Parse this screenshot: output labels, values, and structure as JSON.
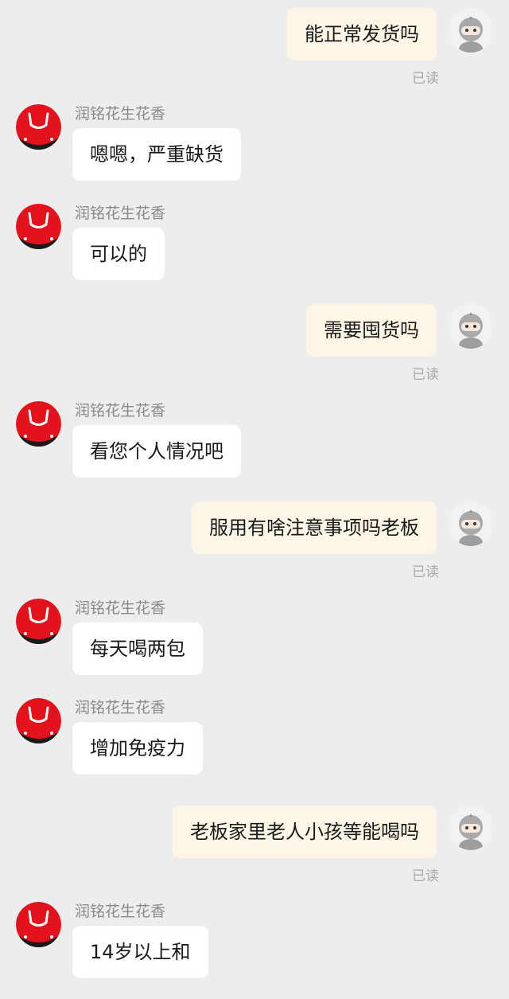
{
  "shop_name": "润铭花生花香",
  "read_label": "已读",
  "messages": [
    {
      "dir": "out",
      "text": "能正常发货吗",
      "status": "已读"
    },
    {
      "dir": "in",
      "sender": "润铭花生花香",
      "text": "嗯嗯，严重缺货"
    },
    {
      "dir": "in",
      "sender": "润铭花生花香",
      "text": "可以的"
    },
    {
      "dir": "out",
      "text": "需要囤货吗",
      "status": "已读"
    },
    {
      "dir": "in",
      "sender": "润铭花生花香",
      "text": "看您个人情况吧"
    },
    {
      "dir": "out",
      "text": "服用有啥注意事项吗老板",
      "status": "已读"
    },
    {
      "dir": "in",
      "sender": "润铭花生花香",
      "text": "每天喝两包"
    },
    {
      "dir": "in",
      "sender": "润铭花生花香",
      "text": "增加免疫力"
    },
    {
      "dir": "out",
      "text": "老板家里老人小孩等能喝吗",
      "status": "已读"
    },
    {
      "dir": "in",
      "sender": "润铭花生花香",
      "text": "14岁以上和"
    }
  ],
  "icons": {
    "user_avatar": "ninja-avatar-icon",
    "shop_avatar": "red-shopping-bag-logo"
  },
  "colors": {
    "background": "#ededed",
    "incoming_bubble": "#ffffff",
    "outgoing_bubble": "#fdf6e6",
    "shop_red": "#e3121c",
    "meta_text": "#8a8a8a"
  }
}
